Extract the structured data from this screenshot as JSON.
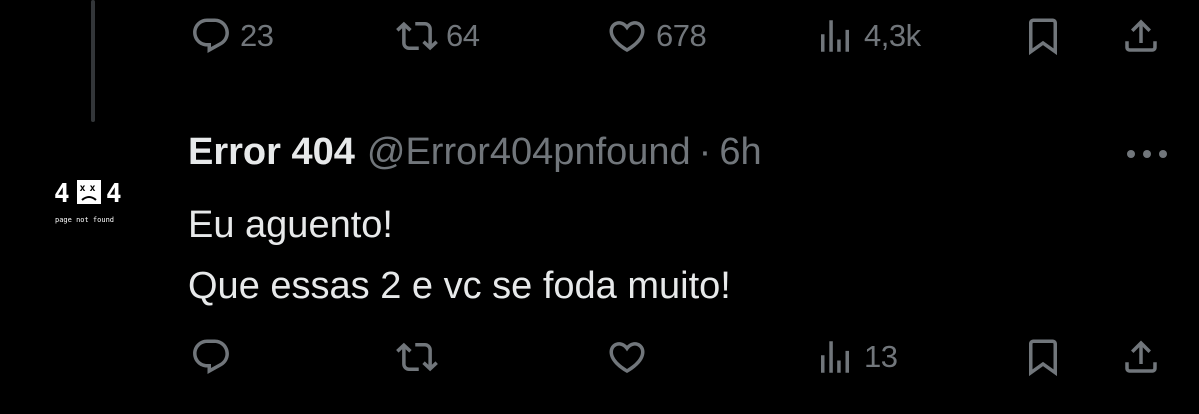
{
  "colors": {
    "background": "#000000",
    "text_primary": "#e7e9ea",
    "text_secondary": "#71767b",
    "thread_line": "#333639"
  },
  "previous_tweet": {
    "actions": {
      "reply": {
        "icon": "reply-icon",
        "count": "23"
      },
      "retweet": {
        "icon": "retweet-icon",
        "count": "64"
      },
      "like": {
        "icon": "heart-icon",
        "count": "678"
      },
      "views": {
        "icon": "views-icon",
        "count": "4,3k"
      },
      "bookmark": {
        "icon": "bookmark-icon"
      },
      "share": {
        "icon": "share-icon"
      }
    }
  },
  "tweet": {
    "avatar": {
      "logo_text": "4 4",
      "logo_subtext": "page not found"
    },
    "display_name": "Error 404",
    "handle": "@Error404pnfound",
    "separator": "·",
    "time": "6h",
    "more_icon": "more-icon",
    "text_lines": [
      "Eu aguento!",
      "Que essas 2 e vc se foda muito!"
    ],
    "actions": {
      "reply": {
        "icon": "reply-icon",
        "count": ""
      },
      "retweet": {
        "icon": "retweet-icon",
        "count": ""
      },
      "like": {
        "icon": "heart-icon",
        "count": ""
      },
      "views": {
        "icon": "views-icon",
        "count": "13"
      },
      "bookmark": {
        "icon": "bookmark-icon"
      },
      "share": {
        "icon": "share-icon"
      }
    }
  }
}
